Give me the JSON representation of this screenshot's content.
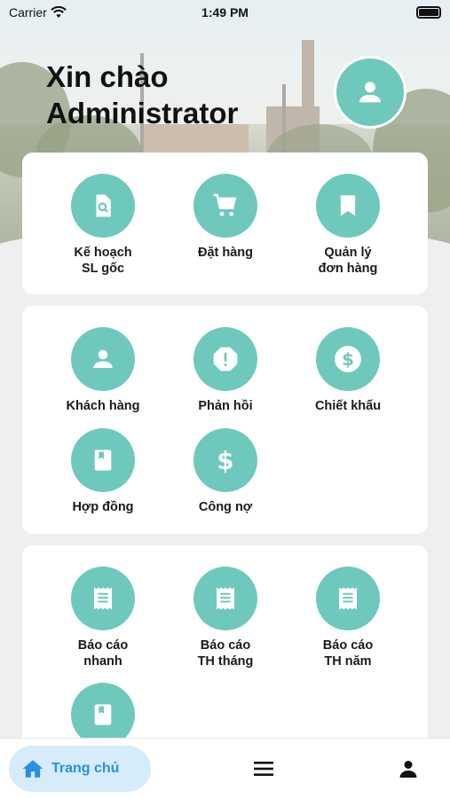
{
  "status_bar": {
    "carrier": "Carrier",
    "time": "1:49 PM"
  },
  "header": {
    "greeting": "Xin chào",
    "user": "Administrator"
  },
  "section1": [
    {
      "label": "Kế hoạch\nSL gốc",
      "icon": "file-search-icon"
    },
    {
      "label": "Đặt hàng",
      "icon": "cart-icon"
    },
    {
      "label": "Quản lý\nđơn hàng",
      "icon": "bookmark-icon"
    }
  ],
  "section2": [
    {
      "label": "Khách hàng",
      "icon": "person-icon"
    },
    {
      "label": "Phản hồi",
      "icon": "alert-icon"
    },
    {
      "label": "Chiết khấu",
      "icon": "dollar-circle-icon"
    },
    {
      "label": "Hợp đồng",
      "icon": "book-icon"
    },
    {
      "label": "Công nợ",
      "icon": "dollar-icon"
    }
  ],
  "section3": [
    {
      "label": "Báo cáo\nnhanh",
      "icon": "receipt-icon"
    },
    {
      "label": "Báo cáo\nTH tháng",
      "icon": "receipt-icon"
    },
    {
      "label": "Báo cáo\nTH năm",
      "icon": "receipt-icon"
    },
    {
      "label": "",
      "icon": "book-icon"
    }
  ],
  "tabbar": {
    "home_label": "Trang chủ"
  },
  "colors": {
    "accent": "#6fc8bc",
    "tab_active": "#2a8fe0",
    "tab_active_bg": "#d6ecfb"
  }
}
